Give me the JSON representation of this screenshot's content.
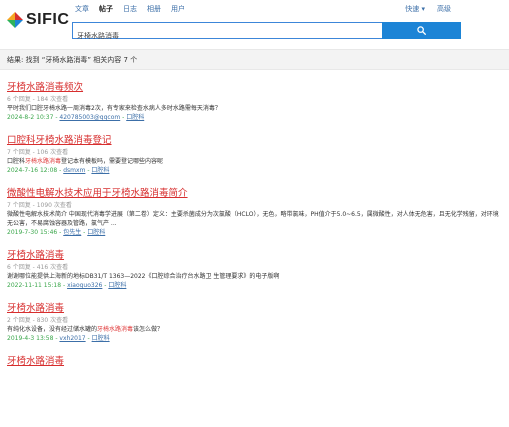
{
  "brand": {
    "logo_text": "SIFIC",
    "colors": [
      "#1c84d6",
      "#d72e2e",
      "#f5a623",
      "#2fb35a"
    ]
  },
  "nav": {
    "items": [
      "文章",
      "帖子",
      "日志",
      "相册",
      "用户"
    ],
    "active": "帖子",
    "right": [
      "快速 ▾",
      "高级"
    ]
  },
  "search": {
    "value": "牙椅水路消毒",
    "button_icon": "search-icon",
    "button_color": "#1c84d6"
  },
  "result_bar": {
    "text": "结果: 找到 “牙椅水路消毒” 相关内容 7 个"
  },
  "results": [
    {
      "title_hl": "牙椅水路消毒",
      "title_rest": "频次",
      "meta": "6 个回复 - 184 次查看",
      "snippet": [
        {
          "t": "平时我们口腔牙椅水路一周消毒2次，有专家来检查水病人多时水路需每天消毒？",
          "hl": false
        }
      ],
      "date": "2024-8-2 10:37",
      "user": "420785003@qqcom",
      "forum": "口腔科"
    },
    {
      "title_pre": "口腔科",
      "title_hl": "牙椅水路消毒",
      "title_rest": "登记",
      "meta": "7 个回复 - 106 次查看",
      "snippet": [
        {
          "t": "口腔科",
          "hl": false
        },
        {
          "t": "牙椅水路消毒",
          "hl": true
        },
        {
          "t": "登记本有模板吗，需要登记哪些内容呢",
          "hl": false
        }
      ],
      "date": "2024-7-16 12:08",
      "user": "dsmxm",
      "forum": "口腔科"
    },
    {
      "title_pre": "微酸性电解水技术应用于",
      "title_hl": "牙椅水路消毒",
      "title_rest": "简介",
      "meta": "7 个回复 - 1090 次查看",
      "snippet": [
        {
          "t": "微酸性电解水技术简介 中国现代消毒学进展（第二卷）定义：主要杀菌成分为次氯酸（HCLO），无色，略带氯味，PH值介于5.0~6.5，属微酸性，对人体无危害，且无化学残留，对环境无公害，不易腐蚀容器及管路，氯气产 ...",
          "hl": false
        }
      ],
      "date": "2019-7-30 15:46",
      "user": "包先生",
      "forum": "口腔科"
    },
    {
      "title_hl": "牙椅水路消毒",
      "title_rest": "",
      "meta": "6 个回复 - 416 次查看",
      "snippet": [
        {
          "t": "谢谢哪位能提供上海新的地标DB31/T 1363—2022《口腔综合治疗台水路卫 生管理要求》的电子版啊",
          "hl": false
        }
      ],
      "date": "2022-11-11 15:18",
      "user": "xiaoguo326",
      "forum": "口腔科"
    },
    {
      "title_hl": "牙椅水路消毒",
      "title_rest": "",
      "meta": "2 个回复 - 830 次查看",
      "snippet": [
        {
          "t": "有纯化水设备，没有经过储水罐的",
          "hl": false
        },
        {
          "t": "牙椅水路消毒",
          "hl": true
        },
        {
          "t": "该怎么做？",
          "hl": false
        }
      ],
      "date": "2019-4-3 13:58",
      "user": "vxh2017",
      "forum": "口腔科"
    },
    {
      "title_hl": "牙椅水路消毒",
      "title_rest": "",
      "meta": "",
      "snippet": [],
      "date": "",
      "user": "",
      "forum": ""
    }
  ]
}
